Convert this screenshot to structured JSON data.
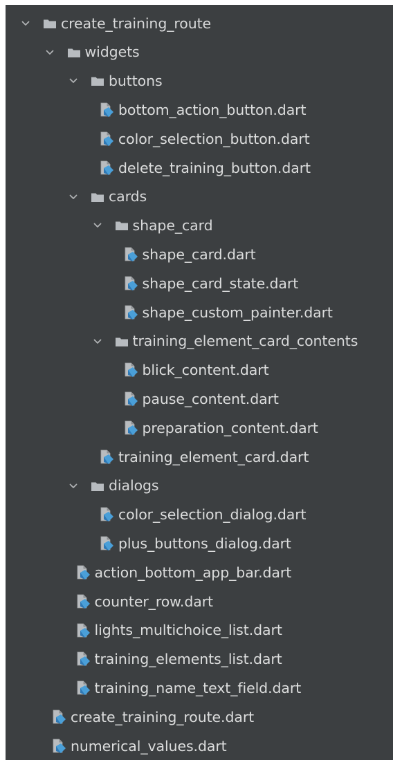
{
  "project_tree": {
    "items": [
      {
        "label": "create_training_route",
        "type": "folder",
        "depth": 0,
        "expanded": true
      },
      {
        "label": "widgets",
        "type": "folder",
        "depth": 1,
        "expanded": true
      },
      {
        "label": "buttons",
        "type": "folder",
        "depth": 2,
        "expanded": true
      },
      {
        "label": "bottom_action_button.dart",
        "type": "file",
        "depth": 3
      },
      {
        "label": "color_selection_button.dart",
        "type": "file",
        "depth": 3
      },
      {
        "label": "delete_training_button.dart",
        "type": "file",
        "depth": 3
      },
      {
        "label": "cards",
        "type": "folder",
        "depth": 2,
        "expanded": true
      },
      {
        "label": "shape_card",
        "type": "folder",
        "depth": 3,
        "expanded": true
      },
      {
        "label": "shape_card.dart",
        "type": "file",
        "depth": 4
      },
      {
        "label": "shape_card_state.dart",
        "type": "file",
        "depth": 4
      },
      {
        "label": "shape_custom_painter.dart",
        "type": "file",
        "depth": 4
      },
      {
        "label": "training_element_card_contents",
        "type": "folder",
        "depth": 3,
        "expanded": true
      },
      {
        "label": "blick_content.dart",
        "type": "file",
        "depth": 4
      },
      {
        "label": "pause_content.dart",
        "type": "file",
        "depth": 4
      },
      {
        "label": "preparation_content.dart",
        "type": "file",
        "depth": 4
      },
      {
        "label": "training_element_card.dart",
        "type": "file",
        "depth": 3
      },
      {
        "label": "dialogs",
        "type": "folder",
        "depth": 2,
        "expanded": true
      },
      {
        "label": "color_selection_dialog.dart",
        "type": "file",
        "depth": 3
      },
      {
        "label": "plus_buttons_dialog.dart",
        "type": "file",
        "depth": 3
      },
      {
        "label": "action_bottom_app_bar.dart",
        "type": "file",
        "depth": 2
      },
      {
        "label": "counter_row.dart",
        "type": "file",
        "depth": 2
      },
      {
        "label": "lights_multichoice_list.dart",
        "type": "file",
        "depth": 2
      },
      {
        "label": "training_elements_list.dart",
        "type": "file",
        "depth": 2
      },
      {
        "label": "training_name_text_field.dart",
        "type": "file",
        "depth": 2
      },
      {
        "label": "create_training_route.dart",
        "type": "file",
        "depth": 1
      },
      {
        "label": "numerical_values.dart",
        "type": "file",
        "depth": 1
      }
    ]
  },
  "colors": {
    "background": "#3c3f41",
    "text": "#d7d8d9",
    "folder": "#b8bcc0",
    "chevron": "#afb1b3",
    "dart_badge": "#4a9fd8"
  },
  "icons": {
    "expanded_chevron": "chevron-down-icon",
    "folder": "folder-icon",
    "dart_file": "dart-file-icon"
  }
}
